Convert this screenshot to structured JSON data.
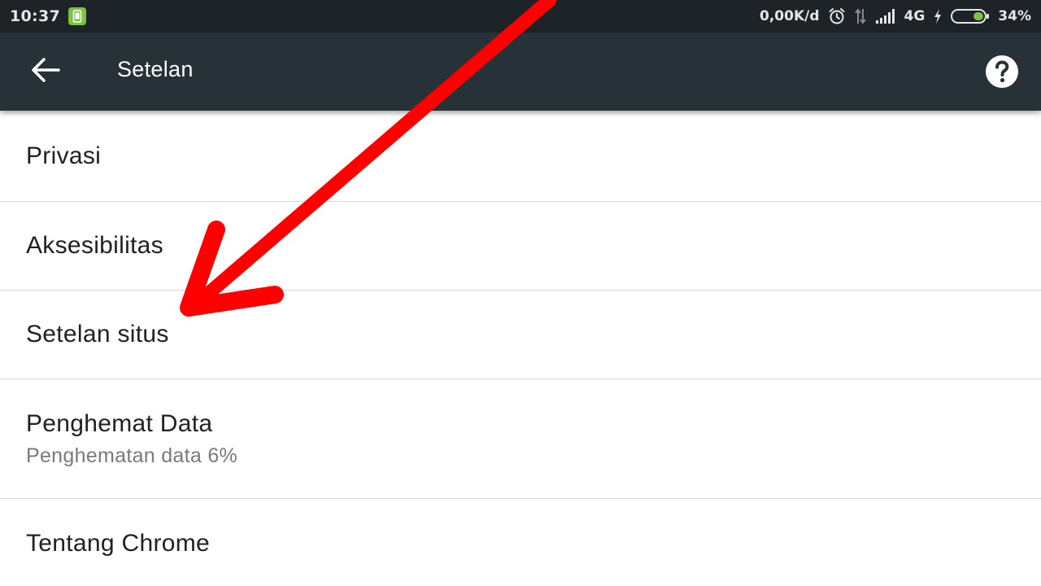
{
  "status_bar": {
    "time": "10:37",
    "network_speed": "0,00K/d",
    "network_type": "4G",
    "battery": "34%",
    "battery_level": 0.34
  },
  "app_bar": {
    "title": "Setelan"
  },
  "settings": {
    "items": [
      {
        "title": "Privasi"
      },
      {
        "title": "Aksesibilitas"
      },
      {
        "title": "Setelan situs"
      },
      {
        "title": "Penghemat Data",
        "subtitle": "Penghematan data 6%"
      },
      {
        "title": "Tentang Chrome"
      }
    ]
  },
  "colors": {
    "app_bar": "#263238",
    "status_bar": "#1d2326",
    "annotation_arrow": "#ff0000",
    "notification_badge": "#7cc142"
  },
  "icons": {
    "back": "arrow-left",
    "help": "question-circle",
    "annotation": "red-arrow"
  }
}
